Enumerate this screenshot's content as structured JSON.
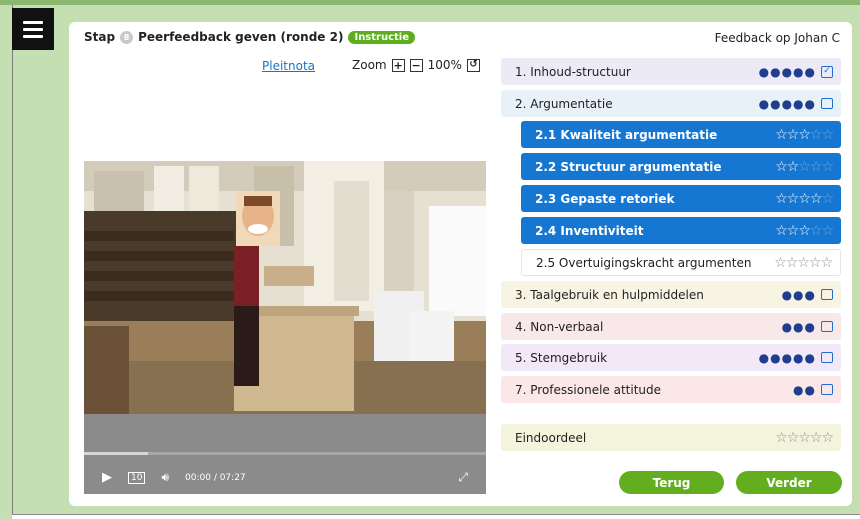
{
  "header": {
    "step_label": "Stap",
    "step_number": "8",
    "step_title": "Peerfeedback geven (ronde 2)",
    "instructie_badge": "Instructie",
    "feedback_target": "Feedback op Johan C"
  },
  "doc_link": "Pleitnota",
  "zoom": {
    "label": "Zoom",
    "plus": "+",
    "minus": "−",
    "value": "100%",
    "reset": "↺"
  },
  "video": {
    "time": "00:00 / 07:27",
    "replay": "10",
    "progress_fraction": 0.16
  },
  "criteria": [
    {
      "label": "1. Inhoud-structuur",
      "dots": "●●●●●",
      "icon": "check-icon",
      "bg": "#eceaf7"
    },
    {
      "label": "2. Argumentatie",
      "dots": "●●●●●",
      "icon": "comment-icon",
      "bg": "#e9f1f8"
    },
    {
      "label": "2.1 Kwaliteit argumentatie",
      "stars_on": "☆☆☆",
      "stars_off": "☆☆",
      "rating": 3
    },
    {
      "label": "2.2 Structuur argumentatie",
      "stars_on": "☆☆",
      "stars_off": "☆☆☆",
      "rating": 2
    },
    {
      "label": "2.3 Gepaste retoriek",
      "stars_on": "☆☆☆☆",
      "stars_off": "☆",
      "rating": 4
    },
    {
      "label": "2.4 Inventiviteit",
      "stars_on": "☆☆☆",
      "stars_off": "☆☆",
      "rating": 3
    },
    {
      "label": "2.5 Overtuigingskracht argumenten",
      "stars": "☆☆☆☆☆",
      "rating": 0
    },
    {
      "label": "3. Taalgebruik en hulpmiddelen",
      "dots": "●●●",
      "icon": "comment-icon",
      "bg": "#f8f4e4"
    },
    {
      "label": "4. Non-verbaal",
      "dots": "●●●",
      "icon": "comment-icon",
      "bg": "#f9e8ea"
    },
    {
      "label": "5. Stemgebruik",
      "dots": "●●●●●",
      "icon": "comment-icon",
      "bg": "#f3e8f7"
    },
    {
      "label": "7. Professionele attitude",
      "dots": "●●",
      "icon": "comment-icon",
      "bg": "#fbe7e7"
    }
  ],
  "final": {
    "label": "Eindoordeel",
    "stars": "☆☆☆☆☆",
    "bg": "#f4f4dd"
  },
  "buttons": {
    "back": "Terug",
    "next": "Verder"
  },
  "colors": {
    "accent_green": "#63ae1f",
    "accent_blue": "#1677d2",
    "dot_navy": "#1f3f8e"
  }
}
